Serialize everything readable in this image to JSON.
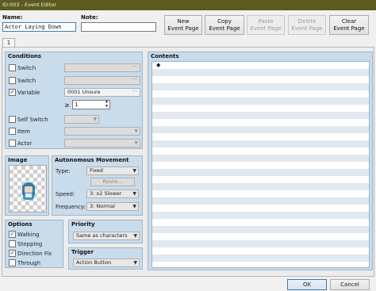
{
  "window": {
    "title": "ID:003 - Event Editor"
  },
  "header": {
    "name_label": "Name:",
    "name_value": "Actor Laying Down",
    "note_label": "Note:",
    "note_value": "",
    "buttons": {
      "new_line1": "New",
      "new_line2": "Event Page",
      "copy_line1": "Copy",
      "copy_line2": "Event Page",
      "paste_line1": "Paste",
      "paste_line2": "Event Page",
      "delete_line1": "Delete",
      "delete_line2": "Event Page",
      "clear_line1": "Clear",
      "clear_line2": "Event Page"
    }
  },
  "tabs": [
    {
      "label": "1"
    }
  ],
  "conditions": {
    "title": "Conditions",
    "switch1": {
      "label": "Switch",
      "checked": false,
      "value": ""
    },
    "switch2": {
      "label": "Switch",
      "checked": false,
      "value": ""
    },
    "variable": {
      "label": "Variable",
      "checked": true,
      "value": "0001 Unsure"
    },
    "compare_symbol": "≥",
    "compare_value": "1",
    "self_switch": {
      "label": "Self Switch",
      "checked": false,
      "value": ""
    },
    "item": {
      "label": "Item",
      "checked": false,
      "value": ""
    },
    "actor": {
      "label": "Actor",
      "checked": false,
      "value": ""
    }
  },
  "image": {
    "title": "Image"
  },
  "movement": {
    "title": "Autonomous Movement",
    "type_label": "Type:",
    "type_value": "Fixed",
    "route_label": "Route...",
    "speed_label": "Speed:",
    "speed_value": "3: x2 Slower",
    "frequency_label": "Frequency:",
    "frequency_value": "3: Normal"
  },
  "options": {
    "title": "Options",
    "items": [
      {
        "label": "Walking",
        "checked": true
      },
      {
        "label": "Stepping",
        "checked": false
      },
      {
        "label": "Direction Fix",
        "checked": true
      },
      {
        "label": "Through",
        "checked": false
      }
    ]
  },
  "priority": {
    "title": "Priority",
    "value": "Same as characters"
  },
  "trigger": {
    "title": "Trigger",
    "value": "Action Button"
  },
  "contents": {
    "title": "Contents",
    "first_line": "◆"
  },
  "footer": {
    "ok_label": "OK",
    "cancel_label": "Cancel"
  },
  "colors": {
    "titlebar": "#5b5b1e",
    "panel_blue": "#c9dcec",
    "stripe": "#e1e8ef"
  },
  "checkmark": "✓",
  "arrow": "▼"
}
